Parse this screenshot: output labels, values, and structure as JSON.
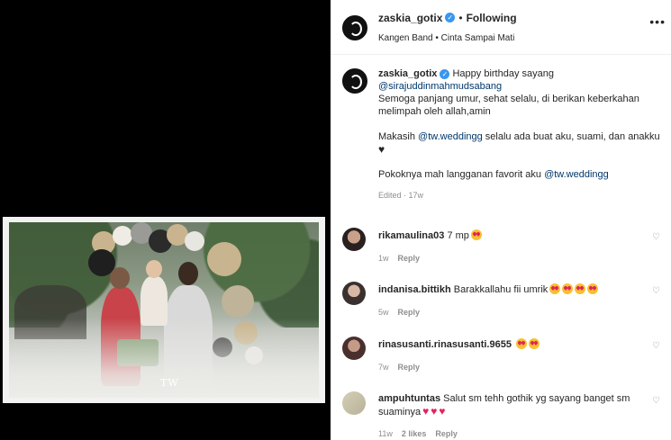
{
  "header": {
    "username": "zaskia_gotix",
    "follow_separator": "•",
    "follow_label": "Following",
    "audio": "Kangen Band • Cinta Sampai Mati",
    "more_label": "•••"
  },
  "caption": {
    "username": "zaskia_gotix",
    "line1": "Happy birthday sayang",
    "mention1": "@sirajuddinmahmudsabang",
    "para1": "Semoga panjang umur, sehat selalu, di berikan keberkahan melimpah oleh allah,amin",
    "para2_pre": "Makasih ",
    "para2_mention": "@tw.weddingg",
    "para2_post": " selalu ada buat aku, suami, dan anakku",
    "para3_pre": "Pokoknya mah langganan favorit aku ",
    "para3_mention": "@tw.weddingg",
    "meta": "Edited · 17w"
  },
  "comments": [
    {
      "username": "rikamaulina03",
      "text": "7 mp",
      "emoji_count": 1,
      "time": "1w",
      "reply": "Reply"
    },
    {
      "username": "indanisa.bittikh",
      "text": "Barakkallahu fii umrik",
      "emoji_count": 4,
      "time": "5w",
      "reply": "Reply"
    },
    {
      "username": "rinasusanti.rinasusanti.9655",
      "text": "",
      "emoji_count": 2,
      "time": "7w",
      "reply": "Reply"
    },
    {
      "username": "ampuhtuntas",
      "text": "Salut sm tehh gothik yg sayang banget sm suaminya",
      "hearts": 3,
      "time": "11w",
      "likes": "2 likes",
      "reply": "Reply"
    }
  ],
  "photo": {
    "watermark": "TW"
  },
  "colors": {
    "accent": "#3897f0",
    "mention": "#00376b",
    "meta": "#8e8e8e",
    "heart": "#e0245e"
  }
}
